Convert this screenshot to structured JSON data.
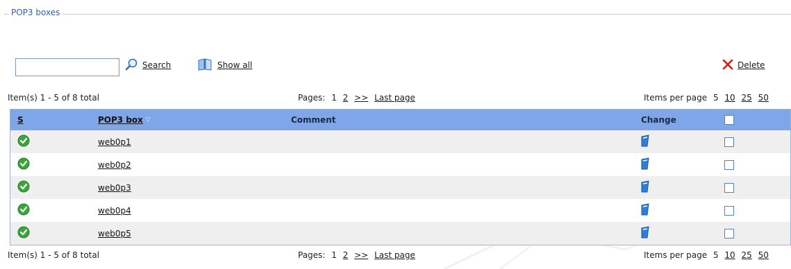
{
  "fieldset": {
    "legend": "POP3 boxes"
  },
  "toolbar": {
    "search_value": "",
    "search_label": "Search",
    "show_all_label": "Show all",
    "delete_label": "Delete"
  },
  "pager": {
    "total_text": "Item(s) 1 - 5 of 8 total",
    "pages_label": "Pages:",
    "pages": [
      "1",
      "2"
    ],
    "next_label": ">>",
    "last_label": "Last page",
    "per_page_label": "Items per page",
    "per_page_options": [
      "5",
      "10",
      "25",
      "50"
    ]
  },
  "table": {
    "headers": {
      "status": "S",
      "box": "POP3 box",
      "comment": "Comment",
      "change": "Change"
    },
    "rows": [
      {
        "box": "web0p1",
        "comment": ""
      },
      {
        "box": "web0p2",
        "comment": ""
      },
      {
        "box": "web0p3",
        "comment": ""
      },
      {
        "box": "web0p4",
        "comment": ""
      },
      {
        "box": "web0p5",
        "comment": ""
      }
    ]
  },
  "colors": {
    "header_bg": "#7fa6e8",
    "legend": "#2a62b8",
    "status_ok": "#3aa63a",
    "delete_icon": "#d11a1a"
  },
  "icons": {
    "search": "magnifier-icon",
    "show_all": "book-icon",
    "delete": "red-x-icon",
    "status": "green-check-icon",
    "edit": "edit-page-icon"
  }
}
